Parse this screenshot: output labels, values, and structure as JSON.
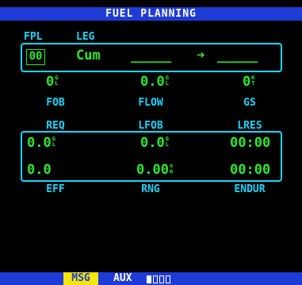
{
  "header": {
    "title": "FUEL PLANNING"
  },
  "fpl": {
    "fpl_label": "FPL",
    "leg_label": "LEG",
    "fpl_number": "00",
    "leg_value": "Cum",
    "from_wpt": "_____",
    "arrow": "➜",
    "to_wpt": "_____"
  },
  "row1": {
    "fob": {
      "value": "0",
      "unit_top": "G",
      "unit_bottom": "L",
      "label": "FOB"
    },
    "flow": {
      "value": "0.0",
      "unit_top": "G",
      "unit_bottom": "L",
      "label": "FLOW"
    },
    "gs": {
      "value": "0",
      "unit_top": "K",
      "unit_bottom": "T",
      "label": "GS"
    }
  },
  "row2_labels": {
    "req": "REQ",
    "lfob": "LFOB",
    "lres": "LRES"
  },
  "row2": {
    "req": {
      "value": "0.0",
      "unit_top": "G",
      "unit_bottom": "L"
    },
    "lfob": {
      "value": "0.0",
      "unit_top": "G",
      "unit_bottom": "L"
    },
    "lres": {
      "value": "00:00"
    }
  },
  "row3": {
    "eff": {
      "value": "0.0"
    },
    "rng": {
      "value": "0.00",
      "unit_top": "n",
      "unit_bottom": "m"
    },
    "endur": {
      "value": "00:00"
    }
  },
  "row3_labels": {
    "eff": "EFF",
    "rng": "RNG",
    "endur": "ENDUR"
  },
  "status_bar": {
    "msg": "MSG",
    "aux": "AUX",
    "page_count": 4,
    "active_page": 1
  },
  "colors": {
    "cyan": "#18d6ff",
    "green": "#2fe62f",
    "blue": "#1f3bd6",
    "yellow": "#f2e60d"
  }
}
